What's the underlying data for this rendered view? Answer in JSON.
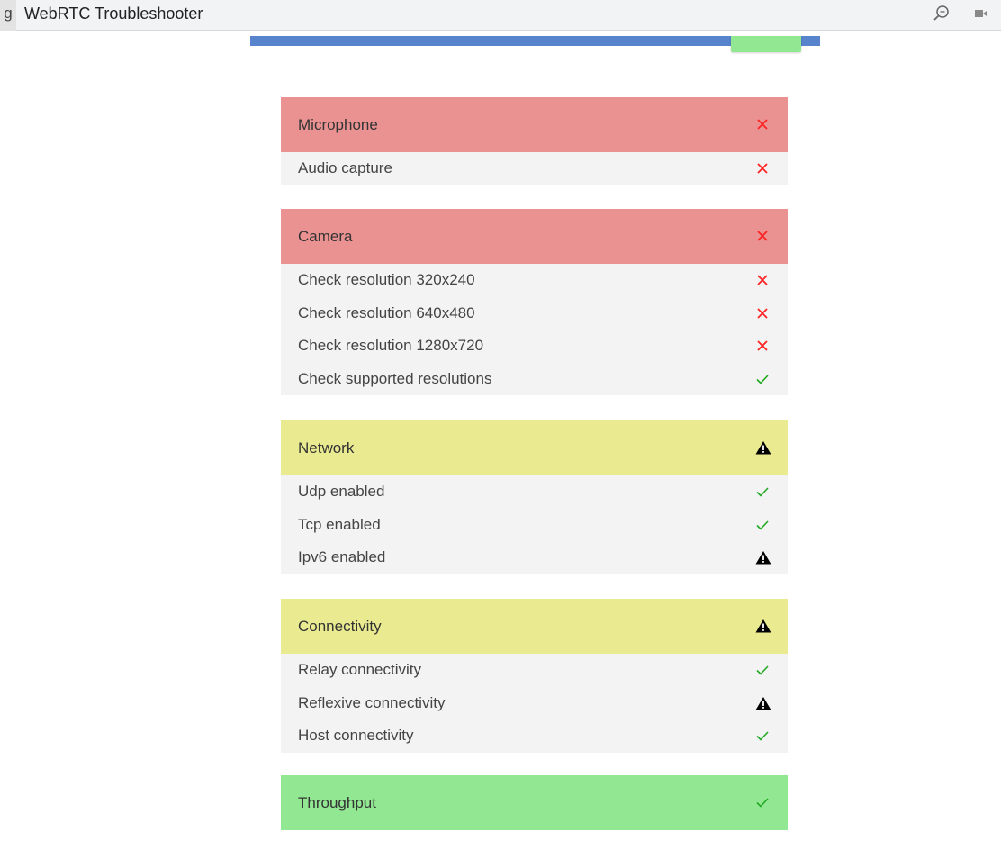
{
  "window": {
    "prev_tab_fragment": "g",
    "title": "WebRTC Troubleshooter"
  },
  "colors": {
    "fail_header": "#ea9292",
    "warn_header": "#eaeb91",
    "pass_header": "#92e792",
    "row_bg": "#f3f3f3",
    "fail_icon": "#ff2020",
    "pass_icon": "#22aa22",
    "warn_icon": "#000000",
    "progress": "#5883cd"
  },
  "sections": [
    {
      "title": "Microphone",
      "status": "fail",
      "tests": [
        {
          "label": "Audio capture",
          "status": "fail"
        }
      ]
    },
    {
      "title": "Camera",
      "status": "fail",
      "tests": [
        {
          "label": "Check resolution 320x240",
          "status": "fail"
        },
        {
          "label": "Check resolution 640x480",
          "status": "fail"
        },
        {
          "label": "Check resolution 1280x720",
          "status": "fail"
        },
        {
          "label": "Check supported resolutions",
          "status": "pass"
        }
      ]
    },
    {
      "title": "Network",
      "status": "warn",
      "tests": [
        {
          "label": "Udp enabled",
          "status": "pass"
        },
        {
          "label": "Tcp enabled",
          "status": "pass"
        },
        {
          "label": "Ipv6 enabled",
          "status": "warn"
        }
      ]
    },
    {
      "title": "Connectivity",
      "status": "warn",
      "tests": [
        {
          "label": "Relay connectivity",
          "status": "pass"
        },
        {
          "label": "Reflexive connectivity",
          "status": "warn"
        },
        {
          "label": "Host connectivity",
          "status": "pass"
        }
      ]
    },
    {
      "title": "Throughput",
      "status": "pass",
      "tests": []
    }
  ]
}
